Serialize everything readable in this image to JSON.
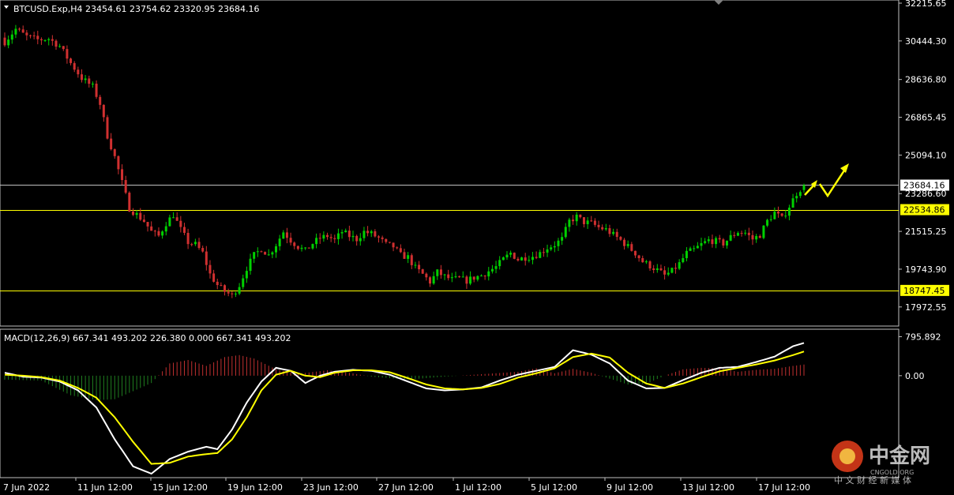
{
  "header": {
    "symbol_line": "BTCUSD.Exp,H4  23454.61 23754.62 23320.95 23684.16",
    "macd_line": "MACD(12,26,9) 667.341 493.202 226.380 0.000 667.341 493.202"
  },
  "colors": {
    "background": "#000000",
    "bull": "#00d000",
    "bear": "#d03030",
    "level": "#ffff00",
    "price_line": "#c0c0c0",
    "macd": "#ffffff",
    "signal": "#ffff00",
    "hist_pos": "#c03030",
    "hist_neg": "#208020"
  },
  "chart_data": {
    "type": "candlestick",
    "symbol": "BTCUSD.Exp",
    "timeframe": "H4",
    "ohlc_last": {
      "open": 23454.61,
      "high": 23754.62,
      "low": 23320.95,
      "close": 23684.16
    },
    "price_ticks": [
      "32215.65",
      "30444.30",
      "28636.80",
      "26865.45",
      "25094.10",
      "23286.60",
      "21515.25",
      "19743.90",
      "17972.55"
    ],
    "price_range": [
      17410,
      32215.65
    ],
    "current_price": 23684.16,
    "levels": [
      22534.86,
      18747.45
    ],
    "level_labels": [
      "22534.86",
      "18747.45"
    ],
    "current_label": "23684.16",
    "x_labels": [
      "7 Jun 2022",
      "11 Jun 12:00",
      "15 Jun 12:00",
      "19 Jun 12:00",
      "23 Jun 12:00",
      "27 Jun 12:00",
      "1 Jul 12:00",
      "5 Jul 12:00",
      "9 Jul 12:00",
      "13 Jul 12:00",
      "17 Jul 12:00"
    ],
    "close_path": [
      [
        0,
        30400
      ],
      [
        3,
        31000
      ],
      [
        6,
        30650
      ],
      [
        9,
        30500
      ],
      [
        12,
        30550
      ],
      [
        15,
        30200
      ],
      [
        18,
        29400
      ],
      [
        21,
        28700
      ],
      [
        24,
        28300
      ],
      [
        26,
        27500
      ],
      [
        28,
        26000
      ],
      [
        30,
        25000
      ],
      [
        32,
        23800
      ],
      [
        34,
        22600
      ],
      [
        36,
        22300
      ],
      [
        38,
        22000
      ],
      [
        40,
        21500
      ],
      [
        42,
        21300
      ],
      [
        44,
        21900
      ],
      [
        46,
        22300
      ],
      [
        48,
        21600
      ],
      [
        50,
        21000
      ],
      [
        52,
        20900
      ],
      [
        54,
        20500
      ],
      [
        56,
        19500
      ],
      [
        58,
        19000
      ],
      [
        60,
        18700
      ],
      [
        62,
        18500
      ],
      [
        64,
        19000
      ],
      [
        66,
        19800
      ],
      [
        68,
        20400
      ],
      [
        70,
        20700
      ],
      [
        72,
        20400
      ],
      [
        74,
        20900
      ],
      [
        76,
        21500
      ],
      [
        78,
        21100
      ],
      [
        80,
        20800
      ],
      [
        82,
        20600
      ],
      [
        84,
        20950
      ],
      [
        86,
        21200
      ],
      [
        88,
        21300
      ],
      [
        90,
        21100
      ],
      [
        92,
        21500
      ],
      [
        94,
        21300
      ],
      [
        96,
        21150
      ],
      [
        98,
        21500
      ],
      [
        100,
        21400
      ],
      [
        102,
        21200
      ],
      [
        104,
        20900
      ],
      [
        106,
        20800
      ],
      [
        108,
        20400
      ],
      [
        110,
        20300
      ],
      [
        112,
        19800
      ],
      [
        114,
        19500
      ],
      [
        116,
        19150
      ],
      [
        118,
        19600
      ],
      [
        120,
        19400
      ],
      [
        122,
        19250
      ],
      [
        124,
        19300
      ],
      [
        126,
        19200
      ],
      [
        128,
        19350
      ],
      [
        130,
        19450
      ],
      [
        132,
        19650
      ],
      [
        134,
        19850
      ],
      [
        136,
        20200
      ],
      [
        138,
        20500
      ],
      [
        140,
        20200
      ],
      [
        142,
        20300
      ],
      [
        144,
        20350
      ],
      [
        146,
        20500
      ],
      [
        148,
        20750
      ],
      [
        150,
        20900
      ],
      [
        152,
        21150
      ],
      [
        154,
        22000
      ],
      [
        156,
        22200
      ],
      [
        158,
        21950
      ],
      [
        160,
        21900
      ],
      [
        162,
        21700
      ],
      [
        164,
        21600
      ],
      [
        166,
        21350
      ],
      [
        168,
        21100
      ],
      [
        170,
        20800
      ],
      [
        172,
        20500
      ],
      [
        174,
        20100
      ],
      [
        176,
        19900
      ],
      [
        178,
        19700
      ],
      [
        180,
        19450
      ],
      [
        182,
        19650
      ],
      [
        184,
        20000
      ],
      [
        186,
        20500
      ],
      [
        188,
        20650
      ],
      [
        190,
        20900
      ],
      [
        192,
        21100
      ],
      [
        194,
        21050
      ],
      [
        196,
        20950
      ],
      [
        198,
        21250
      ],
      [
        200,
        21500
      ],
      [
        202,
        21450
      ],
      [
        204,
        21150
      ],
      [
        206,
        21350
      ],
      [
        208,
        22000
      ],
      [
        210,
        22400
      ],
      [
        212,
        22100
      ],
      [
        214,
        22700
      ],
      [
        216,
        23300
      ],
      [
        218,
        23684.16
      ]
    ],
    "macd": {
      "name": "MACD(12,26,9)",
      "params": "12,26,9",
      "values": {
        "macd": 667.341,
        "signal": 493.202,
        "histogram": 226.38
      },
      "ticks": [
        "795.892",
        "0.00"
      ],
      "range": [
        -2032.237,
        900
      ],
      "macd_path": [
        [
          0,
          60
        ],
        [
          5,
          -20
        ],
        [
          10,
          -40
        ],
        [
          15,
          -120
        ],
        [
          20,
          -300
        ],
        [
          25,
          -650
        ],
        [
          30,
          -1300
        ],
        [
          35,
          -1850
        ],
        [
          40,
          -2000
        ],
        [
          45,
          -1700
        ],
        [
          50,
          -1550
        ],
        [
          55,
          -1450
        ],
        [
          58,
          -1500
        ],
        [
          62,
          -1100
        ],
        [
          66,
          -550
        ],
        [
          70,
          -120
        ],
        [
          74,
          160
        ],
        [
          78,
          100
        ],
        [
          82,
          -150
        ],
        [
          86,
          0
        ],
        [
          90,
          80
        ],
        [
          95,
          120
        ],
        [
          100,
          100
        ],
        [
          105,
          20
        ],
        [
          110,
          -120
        ],
        [
          115,
          -260
        ],
        [
          120,
          -300
        ],
        [
          125,
          -280
        ],
        [
          130,
          -240
        ],
        [
          135,
          -100
        ],
        [
          140,
          20
        ],
        [
          145,
          100
        ],
        [
          150,
          180
        ],
        [
          155,
          520
        ],
        [
          160,
          430
        ],
        [
          165,
          250
        ],
        [
          170,
          -100
        ],
        [
          175,
          -260
        ],
        [
          180,
          -250
        ],
        [
          185,
          -90
        ],
        [
          190,
          60
        ],
        [
          195,
          160
        ],
        [
          200,
          180
        ],
        [
          205,
          280
        ],
        [
          210,
          390
        ],
        [
          215,
          600
        ],
        [
          218,
          667.341
        ]
      ],
      "signal_path": [
        [
          0,
          20
        ],
        [
          5,
          0
        ],
        [
          10,
          -30
        ],
        [
          15,
          -100
        ],
        [
          20,
          -250
        ],
        [
          25,
          -450
        ],
        [
          30,
          -850
        ],
        [
          35,
          -1350
        ],
        [
          40,
          -1800
        ],
        [
          45,
          -1780
        ],
        [
          50,
          -1650
        ],
        [
          55,
          -1600
        ],
        [
          58,
          -1580
        ],
        [
          62,
          -1300
        ],
        [
          66,
          -850
        ],
        [
          70,
          -300
        ],
        [
          74,
          20
        ],
        [
          78,
          100
        ],
        [
          82,
          0
        ],
        [
          86,
          -30
        ],
        [
          90,
          60
        ],
        [
          95,
          110
        ],
        [
          100,
          110
        ],
        [
          105,
          70
        ],
        [
          110,
          -50
        ],
        [
          115,
          -180
        ],
        [
          120,
          -260
        ],
        [
          125,
          -280
        ],
        [
          130,
          -250
        ],
        [
          135,
          -170
        ],
        [
          140,
          -40
        ],
        [
          145,
          50
        ],
        [
          150,
          150
        ],
        [
          155,
          380
        ],
        [
          160,
          450
        ],
        [
          165,
          370
        ],
        [
          170,
          60
        ],
        [
          175,
          -160
        ],
        [
          180,
          -250
        ],
        [
          185,
          -160
        ],
        [
          190,
          -30
        ],
        [
          195,
          90
        ],
        [
          200,
          160
        ],
        [
          205,
          230
        ],
        [
          210,
          310
        ],
        [
          215,
          420
        ],
        [
          218,
          493.202
        ]
      ],
      "hist_path": [
        [
          0,
          -80
        ],
        [
          10,
          -100
        ],
        [
          18,
          -400
        ],
        [
          25,
          -500
        ],
        [
          30,
          -480
        ],
        [
          34,
          -350
        ],
        [
          40,
          -150
        ],
        [
          45,
          250
        ],
        [
          50,
          320
        ],
        [
          55,
          200
        ],
        [
          60,
          380
        ],
        [
          64,
          420
        ],
        [
          68,
          350
        ],
        [
          74,
          130
        ],
        [
          80,
          40
        ],
        [
          88,
          110
        ],
        [
          94,
          60
        ],
        [
          100,
          -20
        ],
        [
          110,
          -80
        ],
        [
          120,
          -20
        ],
        [
          130,
          30
        ],
        [
          140,
          80
        ],
        [
          145,
          150
        ],
        [
          150,
          50
        ],
        [
          155,
          140
        ],
        [
          160,
          60
        ],
        [
          165,
          -60
        ],
        [
          170,
          -180
        ],
        [
          175,
          -170
        ],
        [
          180,
          0
        ],
        [
          185,
          130
        ],
        [
          190,
          160
        ],
        [
          195,
          150
        ],
        [
          200,
          80
        ],
        [
          205,
          120
        ],
        [
          210,
          140
        ],
        [
          215,
          200
        ],
        [
          218,
          226.38
        ]
      ]
    },
    "annotation": "yellow zigzag arrow forecasting upward move"
  },
  "watermark": {
    "brand": "中金网",
    "sub": "中 文 财 经 新 媒 体",
    "domain": "CNGOLD.ORG"
  }
}
